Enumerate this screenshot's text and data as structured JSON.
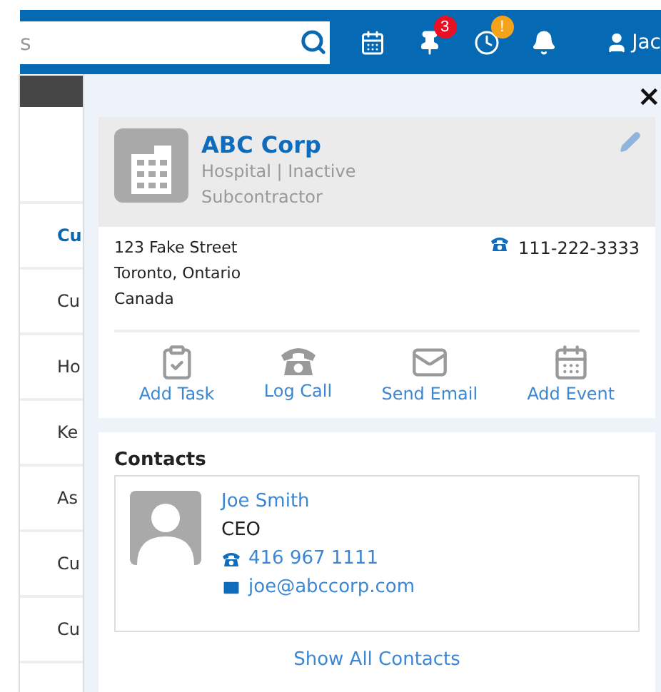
{
  "top_bar": {
    "search": {
      "value": "s"
    },
    "icons": [
      {
        "kind": "calendar"
      },
      {
        "kind": "pin",
        "badge": "3",
        "color": "#e81123"
      },
      {
        "kind": "clock",
        "badge": "!",
        "color": "#f5a31a"
      },
      {
        "kind": "bell"
      }
    ],
    "user": "Jac"
  },
  "list": [
    {
      "text": "Cu",
      "selected": true
    },
    {
      "text": "Cu",
      "selected": false
    },
    {
      "text": "Ho",
      "selected": false
    },
    {
      "text": "Ke",
      "selected": false
    },
    {
      "text": "As",
      "selected": false
    },
    {
      "text": "Cu",
      "selected": false
    },
    {
      "text": "Cu",
      "selected": false
    }
  ],
  "panel": {
    "close": "×",
    "account": {
      "name": "ABC Corp",
      "subtitle": "Hospital | Inactive",
      "type": "Subcontractor",
      "address": [
        "123 Fake Street",
        "Toronto, Ontario",
        "Canada"
      ],
      "phone": "111-222-3333"
    },
    "actions": [
      {
        "kind": "task",
        "label": "Add Task"
      },
      {
        "kind": "call",
        "label": "Log Call"
      },
      {
        "kind": "email",
        "label": "Send Email"
      },
      {
        "kind": "event",
        "label": "Add Event"
      }
    ],
    "contacts": {
      "title": "Contacts",
      "items": [
        {
          "name": "Joe Smith",
          "role": "CEO",
          "phone": "416 967 1111",
          "email": "joe@abccorp.com"
        }
      ],
      "show_all": "Show All Contacts"
    }
  }
}
